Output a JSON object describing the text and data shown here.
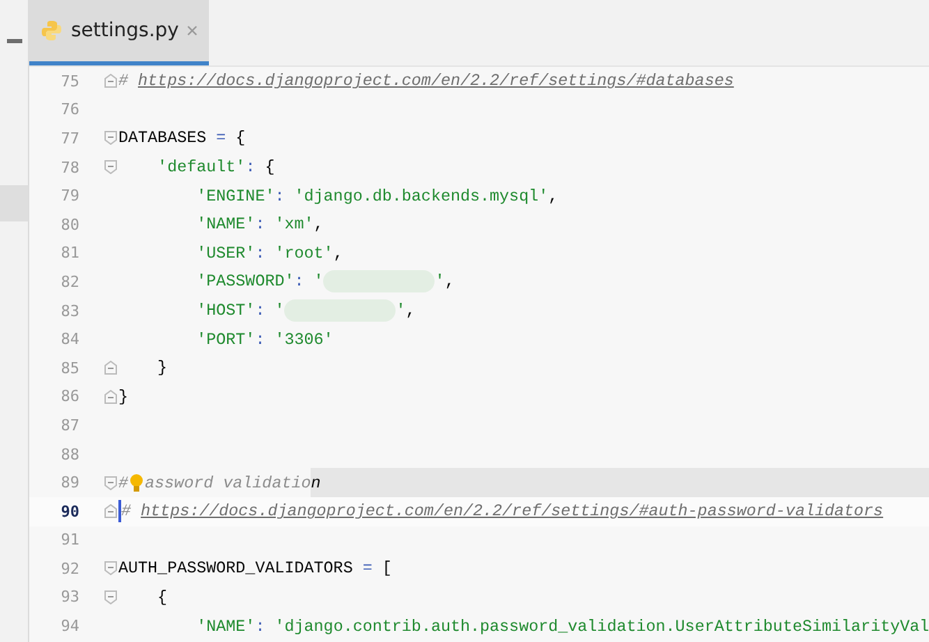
{
  "tabs": [
    {
      "label": "settings.py",
      "selected": true
    }
  ],
  "lines": [
    {
      "number": "75",
      "fold_start": false,
      "fold_end": true,
      "current": false,
      "tokens": [
        {
          "kind": "comment",
          "text": "# "
        },
        {
          "kind": "link",
          "text": "https://docs.djangoproject.com/en/2.2/ref/settings/#databases"
        }
      ]
    },
    {
      "number": "76",
      "fold_start": false,
      "fold_end": false,
      "current": false
    },
    {
      "number": "77",
      "fold_start": true,
      "fold_end": false,
      "current": false,
      "tokens": [
        {
          "kind": "plain",
          "text": "DATABASES "
        },
        {
          "kind": "op",
          "text": "= "
        },
        {
          "kind": "plain",
          "text": "{"
        }
      ]
    },
    {
      "number": "78",
      "fold_start": true,
      "fold_end": false,
      "current": false,
      "tokens": [
        {
          "kind": "string",
          "text": "    'default'"
        },
        {
          "kind": "op",
          "text": ": "
        },
        {
          "kind": "plain",
          "text": "{"
        }
      ]
    },
    {
      "number": "79",
      "fold_start": false,
      "fold_end": false,
      "current": false,
      "tokens": [
        {
          "kind": "string",
          "text": "        'ENGINE'"
        },
        {
          "kind": "op",
          "text": ": "
        },
        {
          "kind": "string",
          "text": "'django.db.backends.mysql'"
        },
        {
          "kind": "plain",
          "text": ","
        }
      ]
    },
    {
      "number": "80",
      "fold_start": false,
      "fold_end": false,
      "current": false,
      "tokens": [
        {
          "kind": "string",
          "text": "        'NAME'"
        },
        {
          "kind": "op",
          "text": ": "
        },
        {
          "kind": "string",
          "text": "'xm'"
        },
        {
          "kind": "plain",
          "text": ","
        }
      ]
    },
    {
      "number": "81",
      "fold_start": false,
      "fold_end": false,
      "current": false,
      "tokens": [
        {
          "kind": "string",
          "text": "        'USER'"
        },
        {
          "kind": "op",
          "text": ": "
        },
        {
          "kind": "string",
          "text": "'root'"
        },
        {
          "kind": "plain",
          "text": ","
        }
      ]
    },
    {
      "number": "82",
      "fold_start": false,
      "fold_end": false,
      "current": false,
      "tokens": [
        {
          "kind": "string",
          "text": "        'PASSWORD'"
        },
        {
          "kind": "op",
          "text": ": "
        },
        {
          "kind": "string",
          "text": "'"
        },
        {
          "kind": "redacted"
        },
        {
          "kind": "string",
          "text": "'"
        },
        {
          "kind": "plain",
          "text": ","
        }
      ]
    },
    {
      "number": "83",
      "fold_start": false,
      "fold_end": false,
      "current": false,
      "tokens": [
        {
          "kind": "string",
          "text": "        'HOST'"
        },
        {
          "kind": "op",
          "text": ": "
        },
        {
          "kind": "string",
          "text": "'"
        },
        {
          "kind": "redacted"
        },
        {
          "kind": "string",
          "text": "'"
        },
        {
          "kind": "plain",
          "text": ","
        }
      ]
    },
    {
      "number": "84",
      "fold_start": false,
      "fold_end": false,
      "current": false,
      "tokens": [
        {
          "kind": "string",
          "text": "        'PORT'"
        },
        {
          "kind": "op",
          "text": ": "
        },
        {
          "kind": "string",
          "text": "'3306'"
        }
      ]
    },
    {
      "number": "85",
      "fold_start": false,
      "fold_end": true,
      "current": false,
      "tokens": [
        {
          "kind": "plain",
          "text": "    }"
        }
      ]
    },
    {
      "number": "86",
      "fold_start": false,
      "fold_end": true,
      "current": false,
      "tokens": [
        {
          "kind": "plain",
          "text": "}"
        }
      ]
    },
    {
      "number": "87",
      "fold_start": false,
      "fold_end": false,
      "current": false
    },
    {
      "number": "88",
      "fold_start": false,
      "fold_end": false,
      "current": false
    },
    {
      "number": "89",
      "fold_start": true,
      "fold_end": false,
      "current": false,
      "bulb": true,
      "tokens": [
        {
          "kind": "comment",
          "text": "#"
        },
        {
          "kind": "comment",
          "text": "assword validatio"
        },
        {
          "kind": "comment",
          "text": "n",
          "highlighted": true
        }
      ]
    },
    {
      "number": "90",
      "fold_start": false,
      "fold_end": true,
      "current": true,
      "tokens": [
        {
          "kind": "comment",
          "text": "# "
        },
        {
          "kind": "link",
          "text": "https://docs.djangoproject.com/en/2.2/ref/settings/#auth-password-validators"
        }
      ]
    },
    {
      "number": "91",
      "fold_start": false,
      "fold_end": false,
      "current": false
    },
    {
      "number": "92",
      "fold_start": true,
      "fold_end": false,
      "current": false,
      "tokens": [
        {
          "kind": "plain",
          "text": "AUTH_PASSWORD_VALIDATORS "
        },
        {
          "kind": "op",
          "text": "= "
        },
        {
          "kind": "plain",
          "text": "["
        }
      ]
    },
    {
      "number": "93",
      "fold_start": true,
      "fold_end": false,
      "current": false,
      "tokens": [
        {
          "kind": "plain",
          "text": "    {"
        }
      ]
    },
    {
      "number": "94",
      "fold_start": false,
      "fold_end": false,
      "current": false,
      "tokens": [
        {
          "kind": "string",
          "text": "        'NAME'"
        },
        {
          "kind": "op",
          "text": ": "
        },
        {
          "kind": "string",
          "text": "'django.contrib.auth.password_validation.UserAttributeSimilarityVal"
        }
      ]
    }
  ]
}
